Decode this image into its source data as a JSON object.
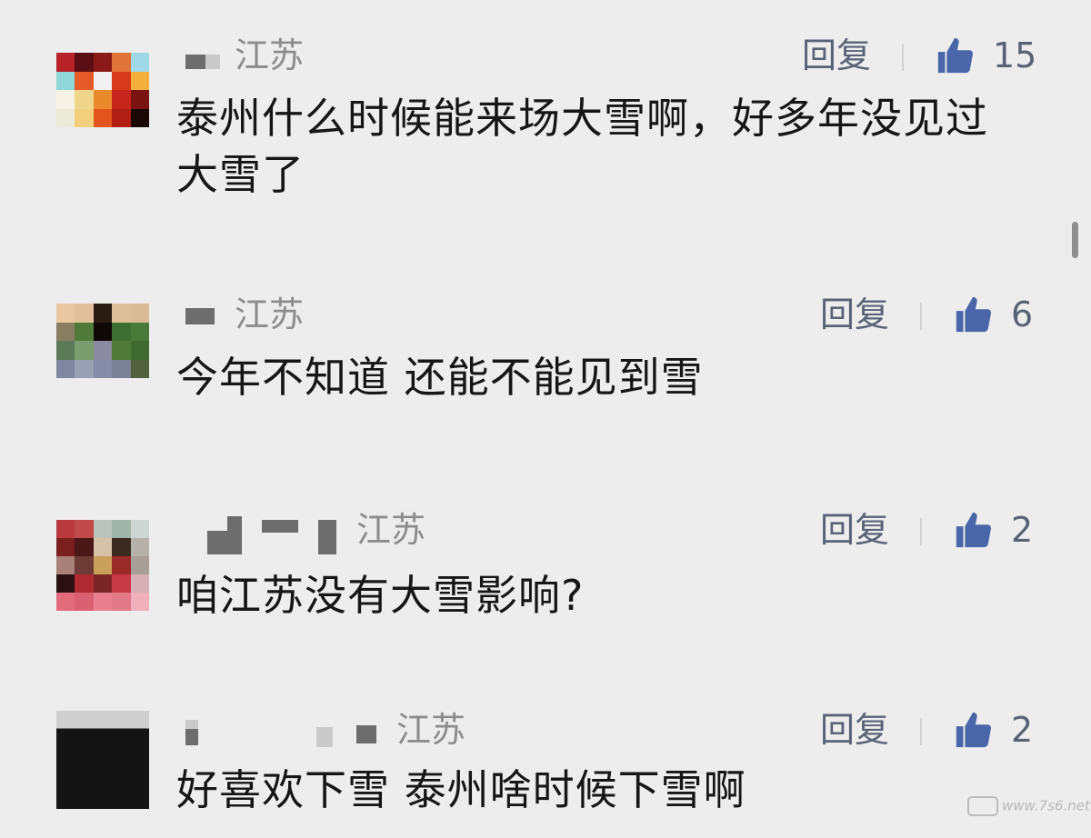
{
  "comments": [
    {
      "region": "江苏",
      "reply": "回复",
      "likes": "15",
      "text": "泰州什么时候能来场大雪啊，好多年没见过大雪了"
    },
    {
      "region": "江苏",
      "reply": "回复",
      "likes": "6",
      "text": "今年不知道 还能不能见到雪"
    },
    {
      "region": "江苏",
      "reply": "回复",
      "likes": "2",
      "text": "咱江苏没有大雪影响?"
    },
    {
      "region": "江苏",
      "reply": "回复",
      "likes": "2",
      "text": "好喜欢下雪 泰州啥时候下雪啊"
    }
  ],
  "icons": {
    "like": "thumbs-up-icon",
    "like_color": "#4a66a8"
  },
  "watermark": "www.7s6.net"
}
